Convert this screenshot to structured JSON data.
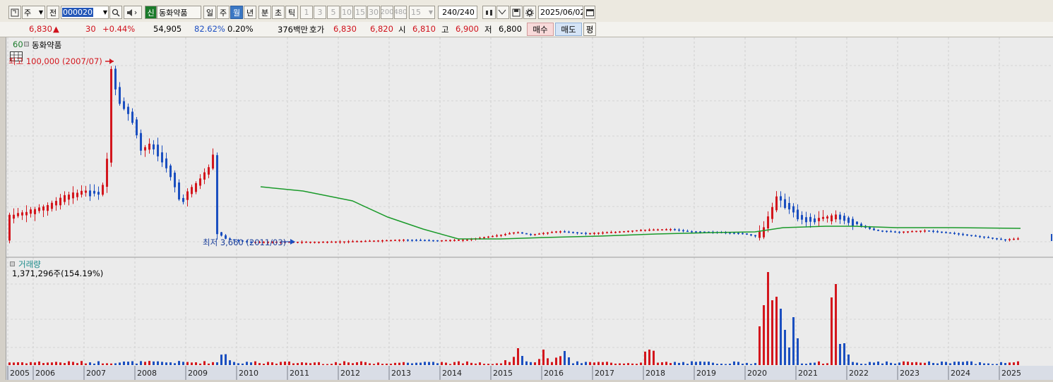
{
  "toolbar": {
    "period_unit": "주",
    "prev_label": "전",
    "stock_code": "000020",
    "shin_badge": "신",
    "stock_name": "동화약품",
    "interval_tabs": [
      "일",
      "주",
      "월",
      "년"
    ],
    "active_tab": "월",
    "sub_tabs": [
      "분",
      "초",
      "틱"
    ],
    "interval_numbers": [
      "1",
      "3",
      "5",
      "10",
      "15",
      "30",
      "200",
      "480"
    ],
    "custom_interval": "15",
    "count_display": "240/240",
    "date": "2025/06/02"
  },
  "quote": {
    "price": "6,830",
    "change_arrow": "▲",
    "change": "30",
    "change_pct": "+0.44%",
    "volume": "54,905",
    "ratio": "82.62%",
    "turnover": "0.20%",
    "amount": "376백만",
    "bid_label": "호가",
    "ask_price": "6,830",
    "bid_price": "6,820",
    "open_label": "시",
    "open": "6,810",
    "high_label": "고",
    "high": "6,900",
    "low_label": "저",
    "low": "6,800",
    "buy_label": "매수",
    "sell_label": "매도",
    "eval_label": "평"
  },
  "price_panel": {
    "ma_period": "60",
    "name": "동화약품",
    "high_marker": "최고 100,000 (2007/07)",
    "low_marker": "최저 3,660 (2011/03)",
    "colors": {
      "up": "#d3161d",
      "down": "#1b4fc0",
      "ma": "#1a9a2a"
    }
  },
  "volume_panel": {
    "title": "거래량",
    "value": "1,371,296주(154.19%)"
  },
  "x_axis": {
    "years": [
      "2005",
      "2006",
      "2007",
      "2008",
      "2009",
      "2010",
      "2011",
      "2012",
      "2013",
      "2014",
      "2015",
      "2016",
      "2017",
      "2018",
      "2019",
      "2020",
      "2021",
      "2022",
      "2023",
      "2024",
      "2025"
    ]
  }
}
